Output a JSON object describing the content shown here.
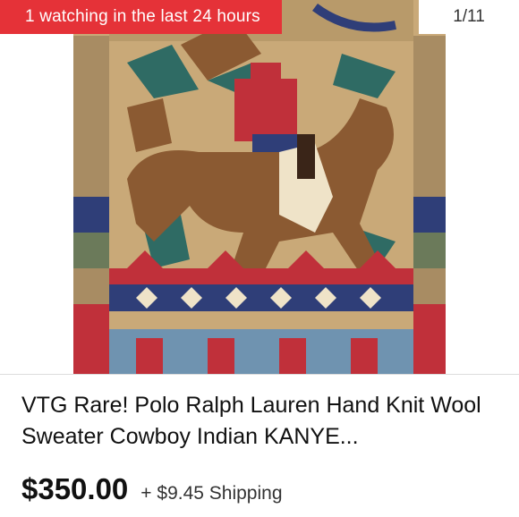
{
  "listing": {
    "watching_badge": "1 watching in the last 24 hours",
    "image_counter": "1/11",
    "title": "VTG Rare! Polo Ralph Lauren Hand Knit Wool Sweater Cowboy Indian KANYE...",
    "price": "$350.00",
    "shipping": "+ $9.45 Shipping"
  },
  "colors": {
    "badge_bg": "#e53238",
    "knit_tan": "#c9a978",
    "horse_brown": "#8b5a32",
    "knit_red": "#c0303a",
    "knit_navy": "#2f3e78",
    "knit_teal": "#2f6b64",
    "knit_cream": "#efe3c8",
    "knit_blue": "#6f93b0"
  }
}
